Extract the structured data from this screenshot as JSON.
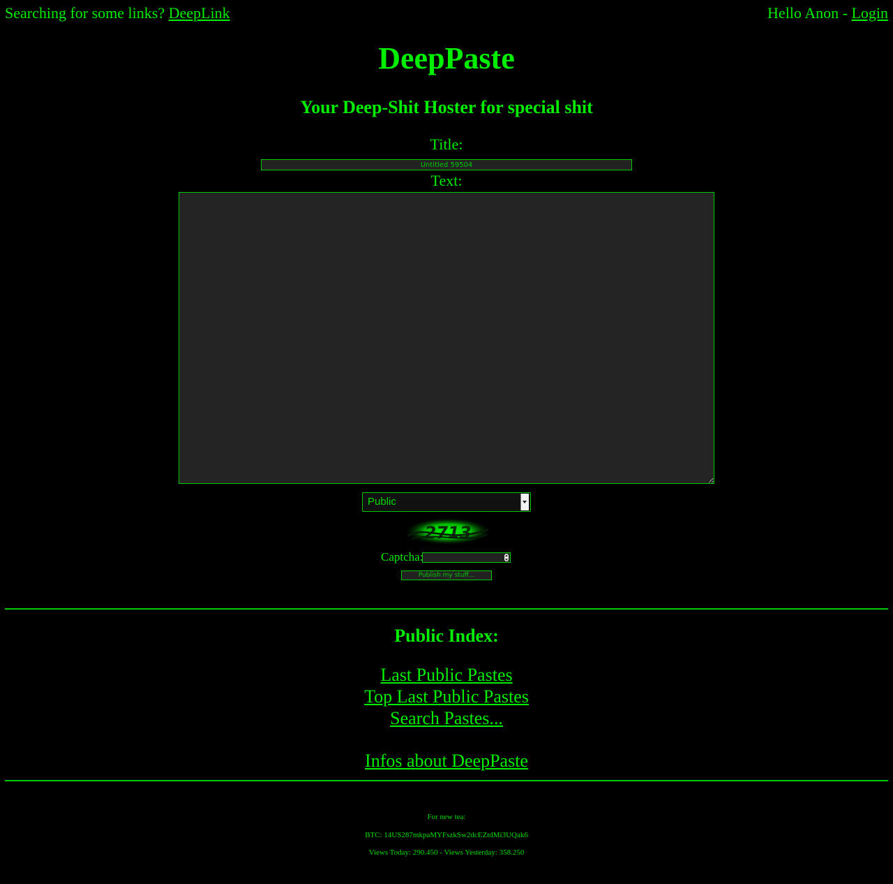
{
  "topbar": {
    "search_prefix": "Searching for some links? ",
    "deeplink_label": "DeepLink",
    "greeting": "Hello Anon - ",
    "login_label": "Login"
  },
  "site": {
    "title": "DeepPaste",
    "tagline": "Your Deep-Shit Hoster for special shit"
  },
  "form": {
    "title_label": "Title:",
    "title_value": "Untitled 59504",
    "text_label": "Text:",
    "text_value": "",
    "visibility_selected": "Public",
    "captcha_image_text": "2713",
    "captcha_label": "Captcha:",
    "captcha_value": "",
    "publish_label": "Publish my stuff..."
  },
  "public_index": {
    "heading": "Public Index:",
    "links": [
      "Last Public Pastes",
      "Top Last Public Pastes",
      "Search Pastes..."
    ],
    "info_link": "Infos about DeepPaste"
  },
  "footer": {
    "tea": "For new tea:",
    "btc": "BTC: 14US287mkpaMYFszkSw2dcEZtdMi3UQak6",
    "views": "Views Today: 290.450 - Views Yesterday: 358.250"
  },
  "colors": {
    "background": "#000000",
    "accent": "#00ee00",
    "field_background": "#222222"
  }
}
